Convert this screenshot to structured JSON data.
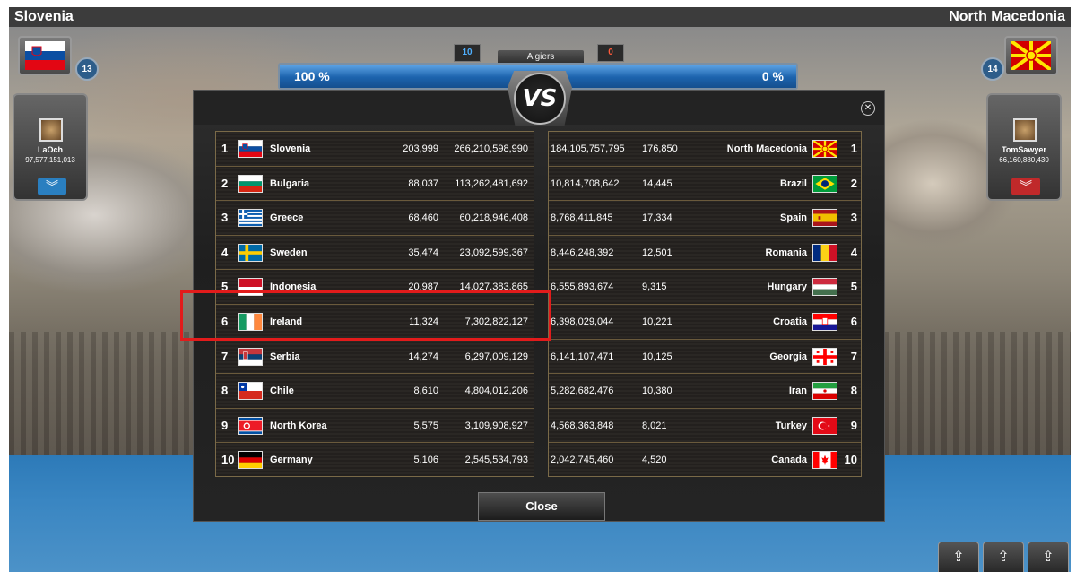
{
  "header": {
    "left_country": "Slovenia",
    "right_country": "North Macedonia"
  },
  "left_player": {
    "level": "13",
    "name": "LaOch",
    "score": "97,577,151,013"
  },
  "right_player": {
    "level": "14",
    "name": "TomSawyer",
    "score": "66,160,880,430"
  },
  "battle": {
    "city": "Algiers",
    "left_wins": "10",
    "right_wins": "0",
    "left_percent": "100 %",
    "right_percent": "0 %",
    "left_fraction": 1.0
  },
  "modal": {
    "vs_label": "VS",
    "close_label": "Close",
    "close_icon": "✕",
    "left_rows": [
      {
        "rank": "1",
        "country": "Slovenia",
        "flag": "slovenia",
        "count": "203,999",
        "damage": "266,210,598,990"
      },
      {
        "rank": "2",
        "country": "Bulgaria",
        "flag": "bulgaria",
        "count": "88,037",
        "damage": "113,262,481,692"
      },
      {
        "rank": "3",
        "country": "Greece",
        "flag": "greece",
        "count": "68,460",
        "damage": "60,218,946,408"
      },
      {
        "rank": "4",
        "country": "Sweden",
        "flag": "sweden",
        "count": "35,474",
        "damage": "23,092,599,367"
      },
      {
        "rank": "5",
        "country": "Indonesia",
        "flag": "indonesia",
        "count": "20,987",
        "damage": "14,027,383,865"
      },
      {
        "rank": "6",
        "country": "Ireland",
        "flag": "ireland",
        "count": "11,324",
        "damage": "7,302,822,127"
      },
      {
        "rank": "7",
        "country": "Serbia",
        "flag": "serbia",
        "count": "14,274",
        "damage": "6,297,009,129"
      },
      {
        "rank": "8",
        "country": "Chile",
        "flag": "chile",
        "count": "8,610",
        "damage": "4,804,012,206"
      },
      {
        "rank": "9",
        "country": "North Korea",
        "flag": "north-korea",
        "count": "5,575",
        "damage": "3,109,908,927"
      },
      {
        "rank": "10",
        "country": "Germany",
        "flag": "germany",
        "count": "5,106",
        "damage": "2,545,534,793"
      }
    ],
    "right_rows": [
      {
        "rank": "1",
        "country": "North Macedonia",
        "flag": "north-macedonia",
        "damage": "184,105,757,795",
        "count": "176,850"
      },
      {
        "rank": "2",
        "country": "Brazil",
        "flag": "brazil",
        "damage": "10,814,708,642",
        "count": "14,445"
      },
      {
        "rank": "3",
        "country": "Spain",
        "flag": "spain",
        "damage": "8,768,411,845",
        "count": "17,334"
      },
      {
        "rank": "4",
        "country": "Romania",
        "flag": "romania",
        "damage": "8,446,248,392",
        "count": "12,501"
      },
      {
        "rank": "5",
        "country": "Hungary",
        "flag": "hungary",
        "damage": "6,555,893,674",
        "count": "9,315"
      },
      {
        "rank": "6",
        "country": "Croatia",
        "flag": "croatia",
        "damage": "6,398,029,044",
        "count": "10,221"
      },
      {
        "rank": "7",
        "country": "Georgia",
        "flag": "georgia",
        "damage": "6,141,107,471",
        "count": "10,125"
      },
      {
        "rank": "8",
        "country": "Iran",
        "flag": "iran",
        "damage": "5,282,682,476",
        "count": "10,380"
      },
      {
        "rank": "9",
        "country": "Turkey",
        "flag": "turkey",
        "damage": "4,568,363,848",
        "count": "8,021"
      },
      {
        "rank": "10",
        "country": "Canada",
        "flag": "canada",
        "damage": "2,042,745,460",
        "count": "4,520"
      }
    ]
  },
  "corner_buttons": [
    "upgrade-icon",
    "upgrade-icon",
    "upgrade-icon"
  ],
  "colors": {
    "highlight": "#e21b1b",
    "progress_fill": "#1c63ad"
  }
}
